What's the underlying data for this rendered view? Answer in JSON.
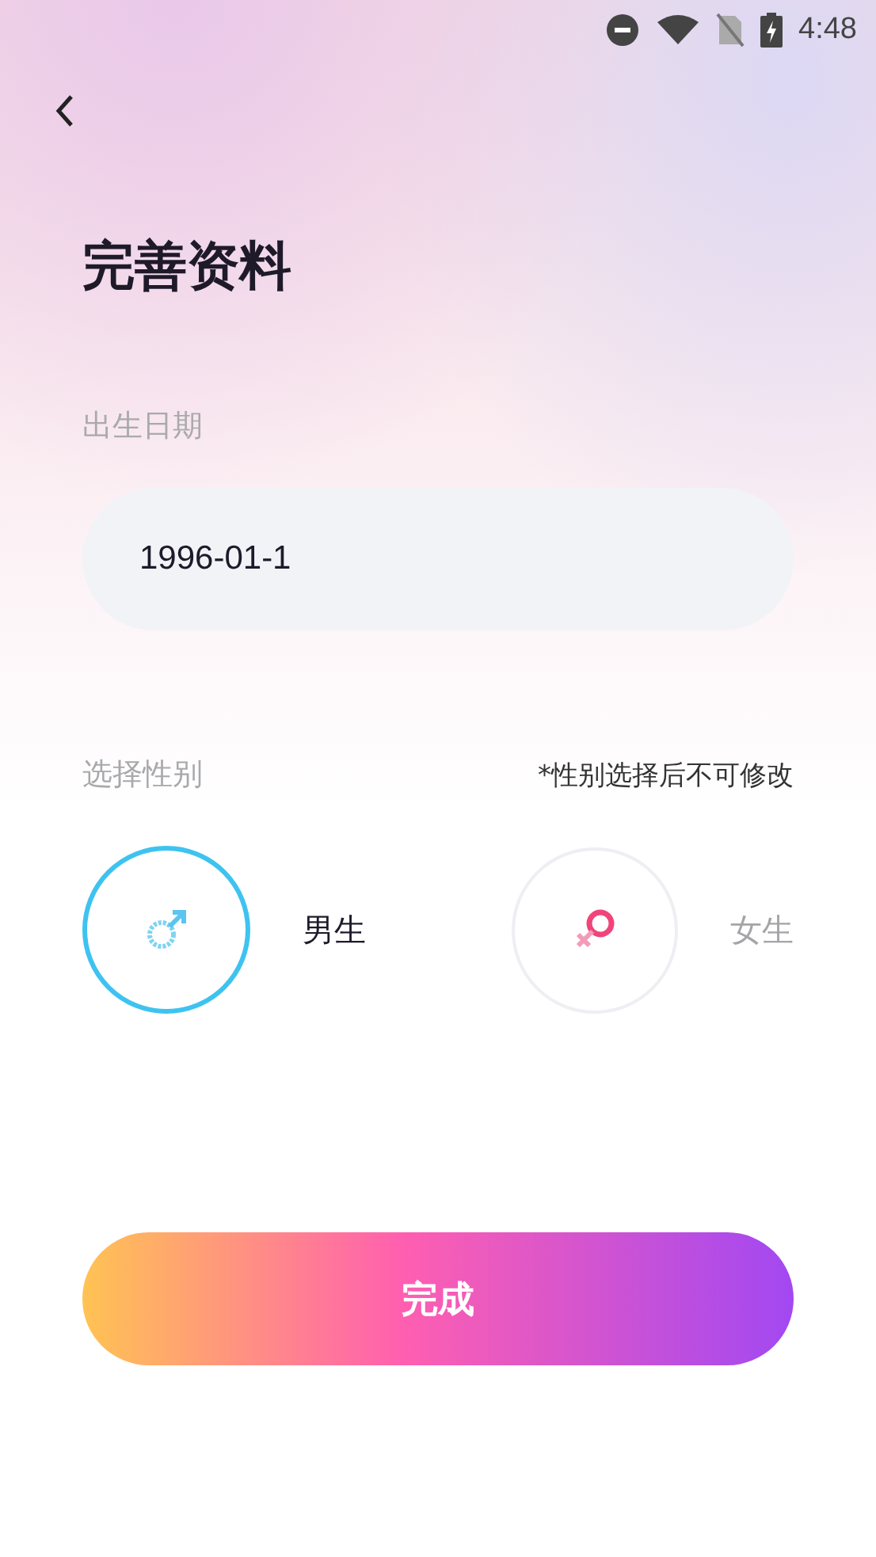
{
  "status_bar": {
    "time": "4:48"
  },
  "title": "完善资料",
  "birth": {
    "label": "出生日期",
    "value": "1996-01-1"
  },
  "gender": {
    "label": "选择性别",
    "note": "*性别选择后不可修改",
    "options": [
      {
        "kind": "male",
        "label": "男生",
        "selected": true
      },
      {
        "kind": "female",
        "label": "女生",
        "selected": false
      }
    ]
  },
  "submit": "完成"
}
